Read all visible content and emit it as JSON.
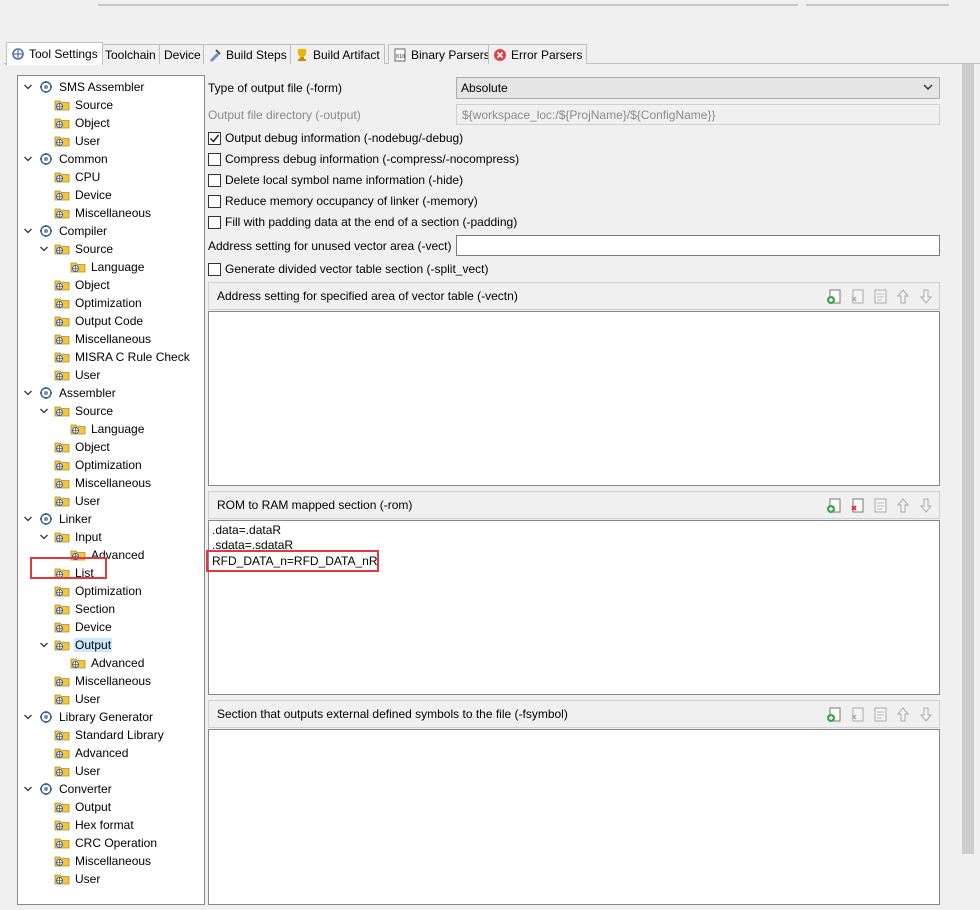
{
  "tabs": [
    {
      "label": "Tool Settings",
      "icon": "tool-settings-icon",
      "active": true
    },
    {
      "label": "Toolchain",
      "icon": "",
      "active": false
    },
    {
      "label": "Device",
      "icon": "",
      "active": false
    },
    {
      "label": "Build Steps",
      "icon": "build-steps-icon",
      "active": false
    },
    {
      "label": "Build Artifact",
      "icon": "build-artifact-icon",
      "active": false
    },
    {
      "label": "Binary Parsers",
      "icon": "binary-parsers-icon",
      "active": false
    },
    {
      "label": "Error Parsers",
      "icon": "error-parsers-icon",
      "active": false
    }
  ],
  "tree": [
    {
      "label": "SMS Assembler",
      "level": 0,
      "expanded": true
    },
    {
      "label": "Source",
      "level": 1
    },
    {
      "label": "Object",
      "level": 1
    },
    {
      "label": "User",
      "level": 1
    },
    {
      "label": "Common",
      "level": 0,
      "expanded": true
    },
    {
      "label": "CPU",
      "level": 1
    },
    {
      "label": "Device",
      "level": 1
    },
    {
      "label": "Miscellaneous",
      "level": 1
    },
    {
      "label": "Compiler",
      "level": 0,
      "expanded": true
    },
    {
      "label": "Source",
      "level": 1,
      "expanded": true
    },
    {
      "label": "Language",
      "level": 2
    },
    {
      "label": "Object",
      "level": 1
    },
    {
      "label": "Optimization",
      "level": 1
    },
    {
      "label": "Output Code",
      "level": 1
    },
    {
      "label": "Miscellaneous",
      "level": 1
    },
    {
      "label": "MISRA C Rule Check",
      "level": 1
    },
    {
      "label": "User",
      "level": 1
    },
    {
      "label": "Assembler",
      "level": 0,
      "expanded": true
    },
    {
      "label": "Source",
      "level": 1,
      "expanded": true
    },
    {
      "label": "Language",
      "level": 2
    },
    {
      "label": "Object",
      "level": 1
    },
    {
      "label": "Optimization",
      "level": 1
    },
    {
      "label": "Miscellaneous",
      "level": 1
    },
    {
      "label": "User",
      "level": 1
    },
    {
      "label": "Linker",
      "level": 0,
      "expanded": true
    },
    {
      "label": "Input",
      "level": 1,
      "expanded": true
    },
    {
      "label": "Advanced",
      "level": 2
    },
    {
      "label": "List",
      "level": 1
    },
    {
      "label": "Optimization",
      "level": 1
    },
    {
      "label": "Section",
      "level": 1
    },
    {
      "label": "Device",
      "level": 1
    },
    {
      "label": "Output",
      "level": 1,
      "expanded": true,
      "selected": true
    },
    {
      "label": "Advanced",
      "level": 2
    },
    {
      "label": "Miscellaneous",
      "level": 1
    },
    {
      "label": "User",
      "level": 1
    },
    {
      "label": "Library Generator",
      "level": 0,
      "expanded": true
    },
    {
      "label": "Standard Library",
      "level": 1
    },
    {
      "label": "Advanced",
      "level": 1
    },
    {
      "label": "User",
      "level": 1
    },
    {
      "label": "Converter",
      "level": 0,
      "expanded": true
    },
    {
      "label": "Output",
      "level": 1
    },
    {
      "label": "Hex format",
      "level": 1
    },
    {
      "label": "CRC Operation",
      "level": 1
    },
    {
      "label": "Miscellaneous",
      "level": 1
    },
    {
      "label": "User",
      "level": 1
    }
  ],
  "form": {
    "output_type_label": "Type of output file (-form)",
    "output_type_value": "Absolute",
    "output_dir_label": "Output file directory (-output)",
    "output_dir_value": "${workspace_loc:/${ProjName}/${ConfigName}}",
    "checkboxes": [
      {
        "label": "Output debug information (-nodebug/-debug)",
        "checked": true
      },
      {
        "label": "Compress debug information (-compress/-nocompress)",
        "checked": false
      },
      {
        "label": "Delete local symbol name information (-hide)",
        "checked": false
      },
      {
        "label": "Reduce memory occupancy of linker (-memory)",
        "checked": false
      },
      {
        "label": "Fill with padding data at the end of a section (-padding)",
        "checked": false
      }
    ],
    "vect_label": "Address setting for unused vector area (-vect)",
    "vect_value": "",
    "split_vect_label": "Generate divided vector table section (-split_vect)",
    "split_vect_checked": false
  },
  "groups": {
    "vectn": {
      "title": "Address setting for specified area of vector table (-vectn)",
      "items": []
    },
    "rom": {
      "title": "ROM to RAM mapped section (-rom)",
      "items": [
        ".data=.dataR",
        ".sdata=.sdataR",
        "RFD_DATA_n=RFD_DATA_nR"
      ]
    },
    "fsymbol": {
      "title": "Section that outputs external defined symbols to the file (-fsymbol)",
      "items": []
    }
  },
  "colors": {
    "highlight_box": "#e0383c",
    "selection": "#cce8ff"
  }
}
